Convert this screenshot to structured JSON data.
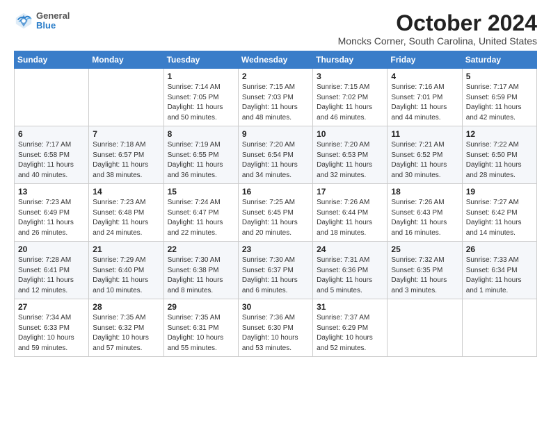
{
  "logo": {
    "general": "General",
    "blue": "Blue"
  },
  "header": {
    "title": "October 2024",
    "location": "Moncks Corner, South Carolina, United States"
  },
  "weekdays": [
    "Sunday",
    "Monday",
    "Tuesday",
    "Wednesday",
    "Thursday",
    "Friday",
    "Saturday"
  ],
  "weeks": [
    [
      {
        "day": "",
        "sunrise": "",
        "sunset": "",
        "daylight": ""
      },
      {
        "day": "",
        "sunrise": "",
        "sunset": "",
        "daylight": ""
      },
      {
        "day": "1",
        "sunrise": "Sunrise: 7:14 AM",
        "sunset": "Sunset: 7:05 PM",
        "daylight": "Daylight: 11 hours and 50 minutes."
      },
      {
        "day": "2",
        "sunrise": "Sunrise: 7:15 AM",
        "sunset": "Sunset: 7:03 PM",
        "daylight": "Daylight: 11 hours and 48 minutes."
      },
      {
        "day": "3",
        "sunrise": "Sunrise: 7:15 AM",
        "sunset": "Sunset: 7:02 PM",
        "daylight": "Daylight: 11 hours and 46 minutes."
      },
      {
        "day": "4",
        "sunrise": "Sunrise: 7:16 AM",
        "sunset": "Sunset: 7:01 PM",
        "daylight": "Daylight: 11 hours and 44 minutes."
      },
      {
        "day": "5",
        "sunrise": "Sunrise: 7:17 AM",
        "sunset": "Sunset: 6:59 PM",
        "daylight": "Daylight: 11 hours and 42 minutes."
      }
    ],
    [
      {
        "day": "6",
        "sunrise": "Sunrise: 7:17 AM",
        "sunset": "Sunset: 6:58 PM",
        "daylight": "Daylight: 11 hours and 40 minutes."
      },
      {
        "day": "7",
        "sunrise": "Sunrise: 7:18 AM",
        "sunset": "Sunset: 6:57 PM",
        "daylight": "Daylight: 11 hours and 38 minutes."
      },
      {
        "day": "8",
        "sunrise": "Sunrise: 7:19 AM",
        "sunset": "Sunset: 6:55 PM",
        "daylight": "Daylight: 11 hours and 36 minutes."
      },
      {
        "day": "9",
        "sunrise": "Sunrise: 7:20 AM",
        "sunset": "Sunset: 6:54 PM",
        "daylight": "Daylight: 11 hours and 34 minutes."
      },
      {
        "day": "10",
        "sunrise": "Sunrise: 7:20 AM",
        "sunset": "Sunset: 6:53 PM",
        "daylight": "Daylight: 11 hours and 32 minutes."
      },
      {
        "day": "11",
        "sunrise": "Sunrise: 7:21 AM",
        "sunset": "Sunset: 6:52 PM",
        "daylight": "Daylight: 11 hours and 30 minutes."
      },
      {
        "day": "12",
        "sunrise": "Sunrise: 7:22 AM",
        "sunset": "Sunset: 6:50 PM",
        "daylight": "Daylight: 11 hours and 28 minutes."
      }
    ],
    [
      {
        "day": "13",
        "sunrise": "Sunrise: 7:23 AM",
        "sunset": "Sunset: 6:49 PM",
        "daylight": "Daylight: 11 hours and 26 minutes."
      },
      {
        "day": "14",
        "sunrise": "Sunrise: 7:23 AM",
        "sunset": "Sunset: 6:48 PM",
        "daylight": "Daylight: 11 hours and 24 minutes."
      },
      {
        "day": "15",
        "sunrise": "Sunrise: 7:24 AM",
        "sunset": "Sunset: 6:47 PM",
        "daylight": "Daylight: 11 hours and 22 minutes."
      },
      {
        "day": "16",
        "sunrise": "Sunrise: 7:25 AM",
        "sunset": "Sunset: 6:45 PM",
        "daylight": "Daylight: 11 hours and 20 minutes."
      },
      {
        "day": "17",
        "sunrise": "Sunrise: 7:26 AM",
        "sunset": "Sunset: 6:44 PM",
        "daylight": "Daylight: 11 hours and 18 minutes."
      },
      {
        "day": "18",
        "sunrise": "Sunrise: 7:26 AM",
        "sunset": "Sunset: 6:43 PM",
        "daylight": "Daylight: 11 hours and 16 minutes."
      },
      {
        "day": "19",
        "sunrise": "Sunrise: 7:27 AM",
        "sunset": "Sunset: 6:42 PM",
        "daylight": "Daylight: 11 hours and 14 minutes."
      }
    ],
    [
      {
        "day": "20",
        "sunrise": "Sunrise: 7:28 AM",
        "sunset": "Sunset: 6:41 PM",
        "daylight": "Daylight: 11 hours and 12 minutes."
      },
      {
        "day": "21",
        "sunrise": "Sunrise: 7:29 AM",
        "sunset": "Sunset: 6:40 PM",
        "daylight": "Daylight: 11 hours and 10 minutes."
      },
      {
        "day": "22",
        "sunrise": "Sunrise: 7:30 AM",
        "sunset": "Sunset: 6:38 PM",
        "daylight": "Daylight: 11 hours and 8 minutes."
      },
      {
        "day": "23",
        "sunrise": "Sunrise: 7:30 AM",
        "sunset": "Sunset: 6:37 PM",
        "daylight": "Daylight: 11 hours and 6 minutes."
      },
      {
        "day": "24",
        "sunrise": "Sunrise: 7:31 AM",
        "sunset": "Sunset: 6:36 PM",
        "daylight": "Daylight: 11 hours and 5 minutes."
      },
      {
        "day": "25",
        "sunrise": "Sunrise: 7:32 AM",
        "sunset": "Sunset: 6:35 PM",
        "daylight": "Daylight: 11 hours and 3 minutes."
      },
      {
        "day": "26",
        "sunrise": "Sunrise: 7:33 AM",
        "sunset": "Sunset: 6:34 PM",
        "daylight": "Daylight: 11 hours and 1 minute."
      }
    ],
    [
      {
        "day": "27",
        "sunrise": "Sunrise: 7:34 AM",
        "sunset": "Sunset: 6:33 PM",
        "daylight": "Daylight: 10 hours and 59 minutes."
      },
      {
        "day": "28",
        "sunrise": "Sunrise: 7:35 AM",
        "sunset": "Sunset: 6:32 PM",
        "daylight": "Daylight: 10 hours and 57 minutes."
      },
      {
        "day": "29",
        "sunrise": "Sunrise: 7:35 AM",
        "sunset": "Sunset: 6:31 PM",
        "daylight": "Daylight: 10 hours and 55 minutes."
      },
      {
        "day": "30",
        "sunrise": "Sunrise: 7:36 AM",
        "sunset": "Sunset: 6:30 PM",
        "daylight": "Daylight: 10 hours and 53 minutes."
      },
      {
        "day": "31",
        "sunrise": "Sunrise: 7:37 AM",
        "sunset": "Sunset: 6:29 PM",
        "daylight": "Daylight: 10 hours and 52 minutes."
      },
      {
        "day": "",
        "sunrise": "",
        "sunset": "",
        "daylight": ""
      },
      {
        "day": "",
        "sunrise": "",
        "sunset": "",
        "daylight": ""
      }
    ]
  ]
}
